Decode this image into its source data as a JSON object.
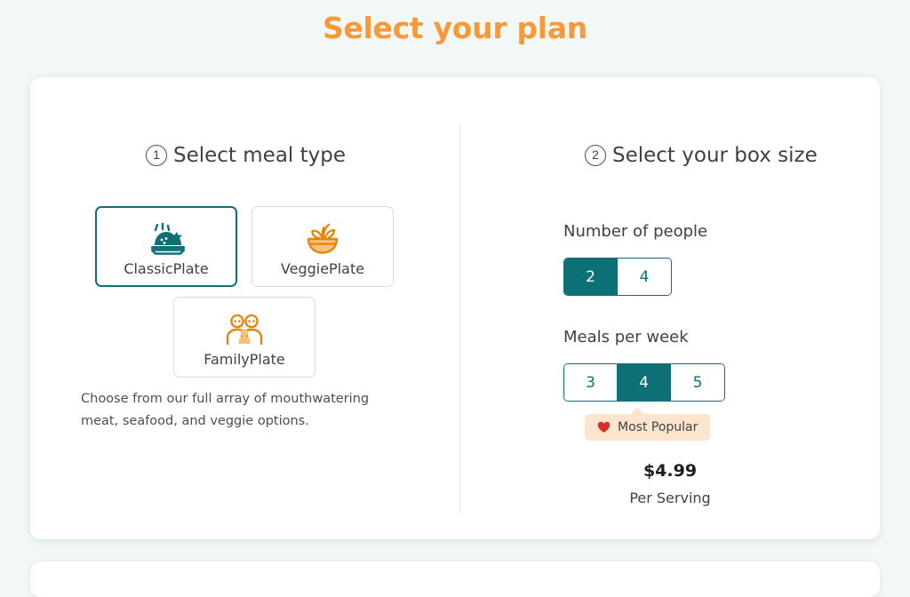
{
  "page": {
    "title": "Select your plan",
    "title_color": "#f89938",
    "background": "#f1f8f7"
  },
  "theme": {
    "teal": "#0d7076",
    "orange": "#e8840c",
    "orange_light": "#f7c27a",
    "badge_bg": "#fde4cf",
    "heart_red": "#d93025"
  },
  "meal_type": {
    "step_number": "1",
    "heading": "Select meal type",
    "options": [
      {
        "label": "ClassicPlate",
        "icon": "roast-chicken-icon",
        "selected": true
      },
      {
        "label": "VeggiePlate",
        "icon": "salad-bowl-icon",
        "selected": false
      },
      {
        "label": "FamilyPlate",
        "icon": "family-icon",
        "selected": false
      }
    ],
    "description": "Choose from our full array of mouthwatering meat, seafood, and veggie options."
  },
  "box_size": {
    "step_number": "2",
    "heading": "Select your box size",
    "people": {
      "label": "Number of people",
      "options": [
        "2",
        "4"
      ],
      "selected": "2"
    },
    "meals": {
      "label": "Meals per week",
      "options": [
        "3",
        "4",
        "5"
      ],
      "selected": "4"
    },
    "badge": {
      "label": "Most Popular",
      "icon": "heart-icon"
    },
    "price": "$4.99",
    "price_caption": "Per Serving"
  }
}
